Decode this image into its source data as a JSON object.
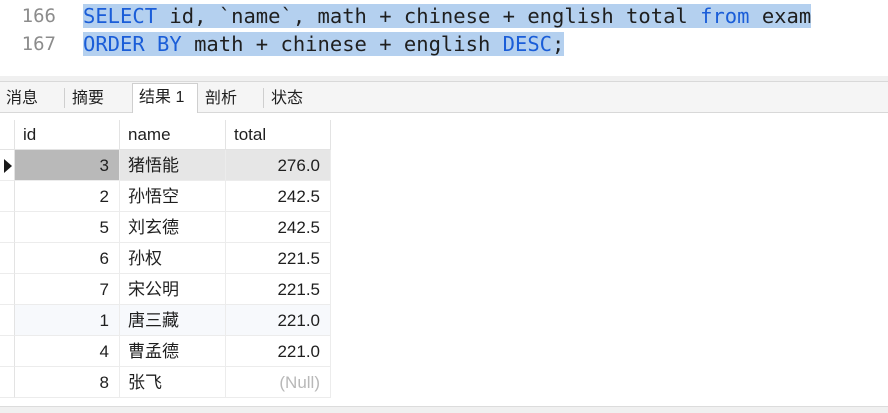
{
  "editor": {
    "lines": [
      {
        "number": "166",
        "tokens": [
          {
            "text": "SELECT",
            "kw": true
          },
          {
            "text": " id, `name`, math + chinese + english total ",
            "kw": false
          },
          {
            "text": "from",
            "kw": true
          },
          {
            "text": " exam",
            "kw": false
          }
        ]
      },
      {
        "number": "167",
        "tokens": [
          {
            "text": "ORDER BY",
            "kw": true
          },
          {
            "text": " math + chinese + english ",
            "kw": false
          },
          {
            "text": "DESC",
            "kw": true
          },
          {
            "text": ";",
            "kw": false
          }
        ]
      }
    ]
  },
  "tabs": [
    {
      "label": "消息",
      "active": false
    },
    {
      "label": "摘要",
      "active": false
    },
    {
      "label": "结果 1",
      "active": true
    },
    {
      "label": "剖析",
      "active": false
    },
    {
      "label": "状态",
      "active": false
    }
  ],
  "grid": {
    "columns": [
      "id",
      "name",
      "total"
    ],
    "current_row": 0,
    "rows": [
      {
        "id": "3",
        "name": "猪悟能",
        "total": "276.0"
      },
      {
        "id": "2",
        "name": "孙悟空",
        "total": "242.5"
      },
      {
        "id": "5",
        "name": "刘玄德",
        "total": "242.5"
      },
      {
        "id": "6",
        "name": "孙权",
        "total": "221.5"
      },
      {
        "id": "7",
        "name": "宋公明",
        "total": "221.5"
      },
      {
        "id": "1",
        "name": "唐三藏",
        "total": "221.0"
      },
      {
        "id": "4",
        "name": "曹孟德",
        "total": "221.0"
      },
      {
        "id": "8",
        "name": "张飞",
        "total": "(Null)"
      }
    ]
  },
  "colors": {
    "selection": "#b4d0ef",
    "keyword": "#1a5dd8",
    "current_row_id_bg": "#b9b9b9",
    "current_row_bg": "#e6e6e6",
    "alt_row_bg": "#f7f9fc"
  }
}
